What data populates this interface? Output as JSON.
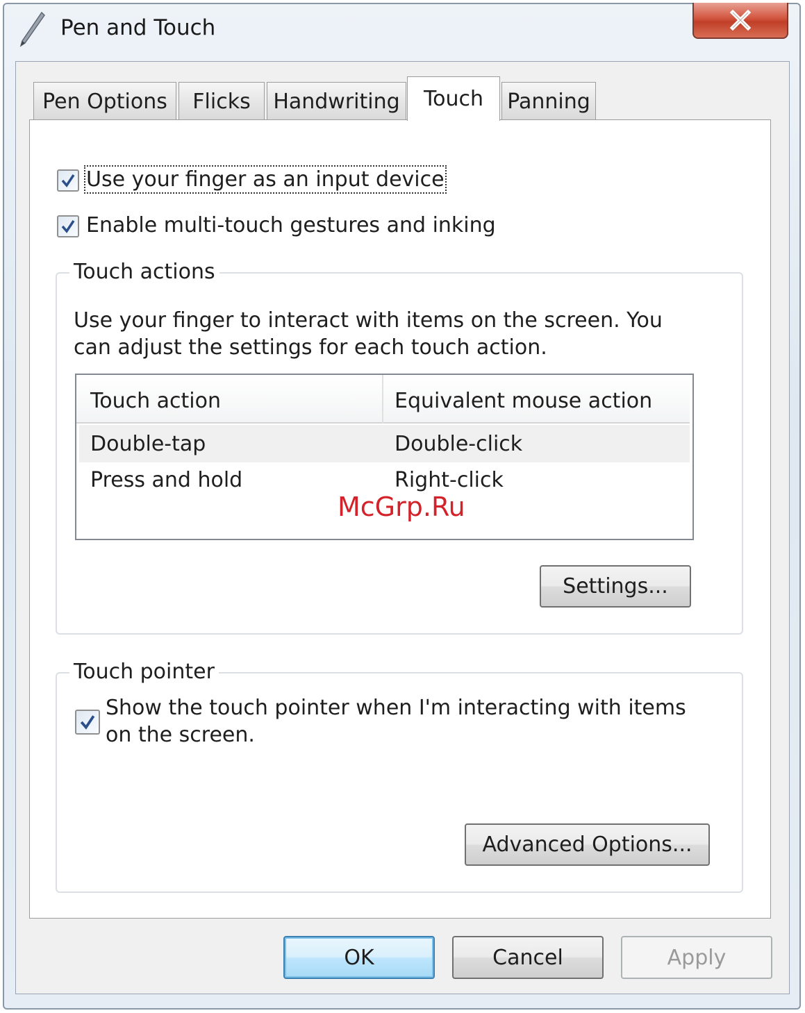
{
  "window": {
    "title": "Pen and Touch",
    "close_icon": "close-icon"
  },
  "tabs": [
    {
      "label": "Pen Options",
      "active": false
    },
    {
      "label": "Flicks",
      "active": false
    },
    {
      "label": "Handwriting",
      "active": false
    },
    {
      "label": "Touch",
      "active": true
    },
    {
      "label": "Panning",
      "active": false
    }
  ],
  "touch": {
    "use_finger": {
      "label": "Use your finger as an input device",
      "checked": true
    },
    "multi_touch": {
      "label": "Enable multi-touch gestures and inking",
      "checked": true
    },
    "touch_actions": {
      "legend": "Touch actions",
      "description_line1": "Use your finger to interact with items on the screen. You",
      "description_line2": "can adjust the settings for each touch action.",
      "columns": [
        "Touch action",
        "Equivalent mouse action"
      ],
      "rows": [
        {
          "action": "Double-tap",
          "mouse": "Double-click",
          "selected": true
        },
        {
          "action": "Press and hold",
          "mouse": "Right-click",
          "selected": false
        }
      ],
      "settings_button": "Settings..."
    },
    "touch_pointer": {
      "legend": "Touch pointer",
      "show_pointer_line1": "Show the touch pointer when I'm interacting with items",
      "show_pointer_line2": "on the screen.",
      "checked": true,
      "advanced_button": "Advanced Options..."
    }
  },
  "footer": {
    "ok": "OK",
    "cancel": "Cancel",
    "apply": "Apply",
    "apply_enabled": false
  },
  "watermark": "McGrp.Ru",
  "colors": {
    "close_button": "#c94a33",
    "default_button_border": "#3c7fb1",
    "watermark": "#d4222a"
  }
}
